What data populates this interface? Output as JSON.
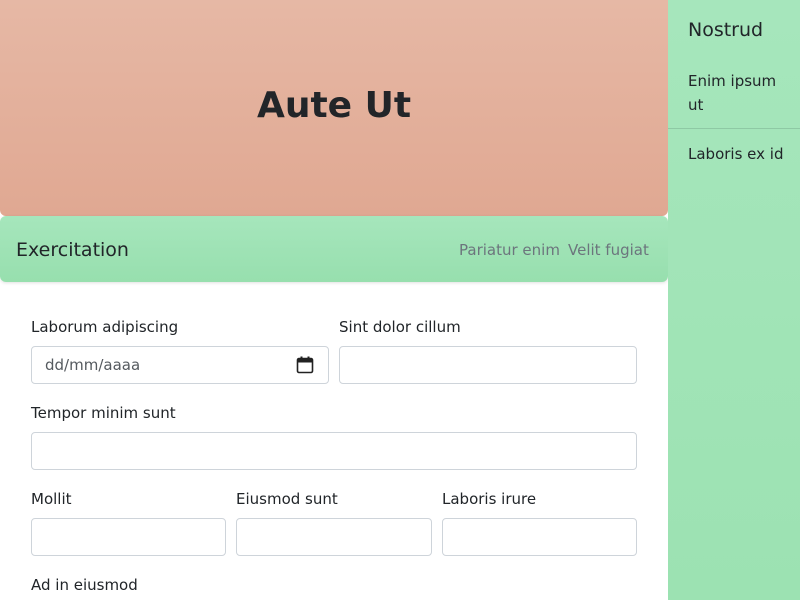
{
  "hero": {
    "title": "Aute Ut"
  },
  "navbar": {
    "brand": "Exercitation",
    "links": [
      "Pariatur enim",
      "Velit fugiat"
    ]
  },
  "form": {
    "labels": {
      "date": "Laborum adipiscing",
      "sint": "Sint dolor cillum",
      "tempor": "Tempor minim sunt",
      "mollit": "Mollit",
      "eiusmod": "Eiusmod sunt",
      "laboris": "Laboris irure",
      "adin": "Ad in eiusmod"
    },
    "date_placeholder": "dd/mm/aaaa"
  },
  "sidebar": {
    "title": "Nostrud",
    "items": [
      "Enim ipsum ut",
      "Laboris ex id"
    ]
  },
  "colors": {
    "hero": "#e3b09c",
    "navbar": "#a0e3b6",
    "sidebar": "#a6e6bc",
    "muted_link": "#6c757d"
  }
}
